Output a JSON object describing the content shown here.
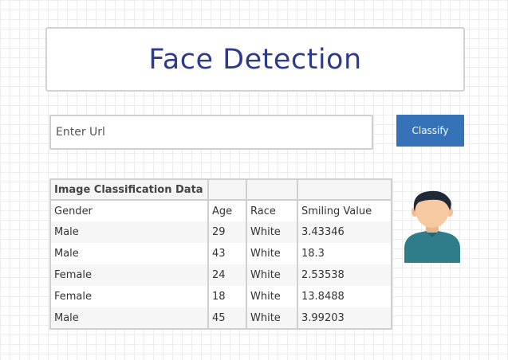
{
  "header": {
    "title": "Face Detection"
  },
  "form": {
    "url_placeholder": "Enter Url",
    "url_value": "",
    "classify_label": "Classify"
  },
  "table": {
    "caption": "Image Classification Data",
    "columns": [
      "Gender",
      "Age",
      "Race",
      "Smiling Value"
    ],
    "rows": [
      {
        "gender": "Male",
        "age": "29",
        "race": "White",
        "smiling": "3.43346"
      },
      {
        "gender": "Male",
        "age": "43",
        "race": "White",
        "smiling": "18.3"
      },
      {
        "gender": "Female",
        "age": "24",
        "race": "White",
        "smiling": "2.53538"
      },
      {
        "gender": "Female",
        "age": "18",
        "race": "White",
        "smiling": "13.8488"
      },
      {
        "gender": "Male",
        "age": "45",
        "race": "White",
        "smiling": "3.99203"
      }
    ]
  },
  "avatar": {
    "icon": "user-avatar-icon"
  },
  "colors": {
    "title": "#2e3a8c",
    "button": "#3572b8",
    "border": "#cfcfcf",
    "shirt": "#2f7c8a",
    "hair": "#1f2a36",
    "skin": "#f7c9a0"
  }
}
